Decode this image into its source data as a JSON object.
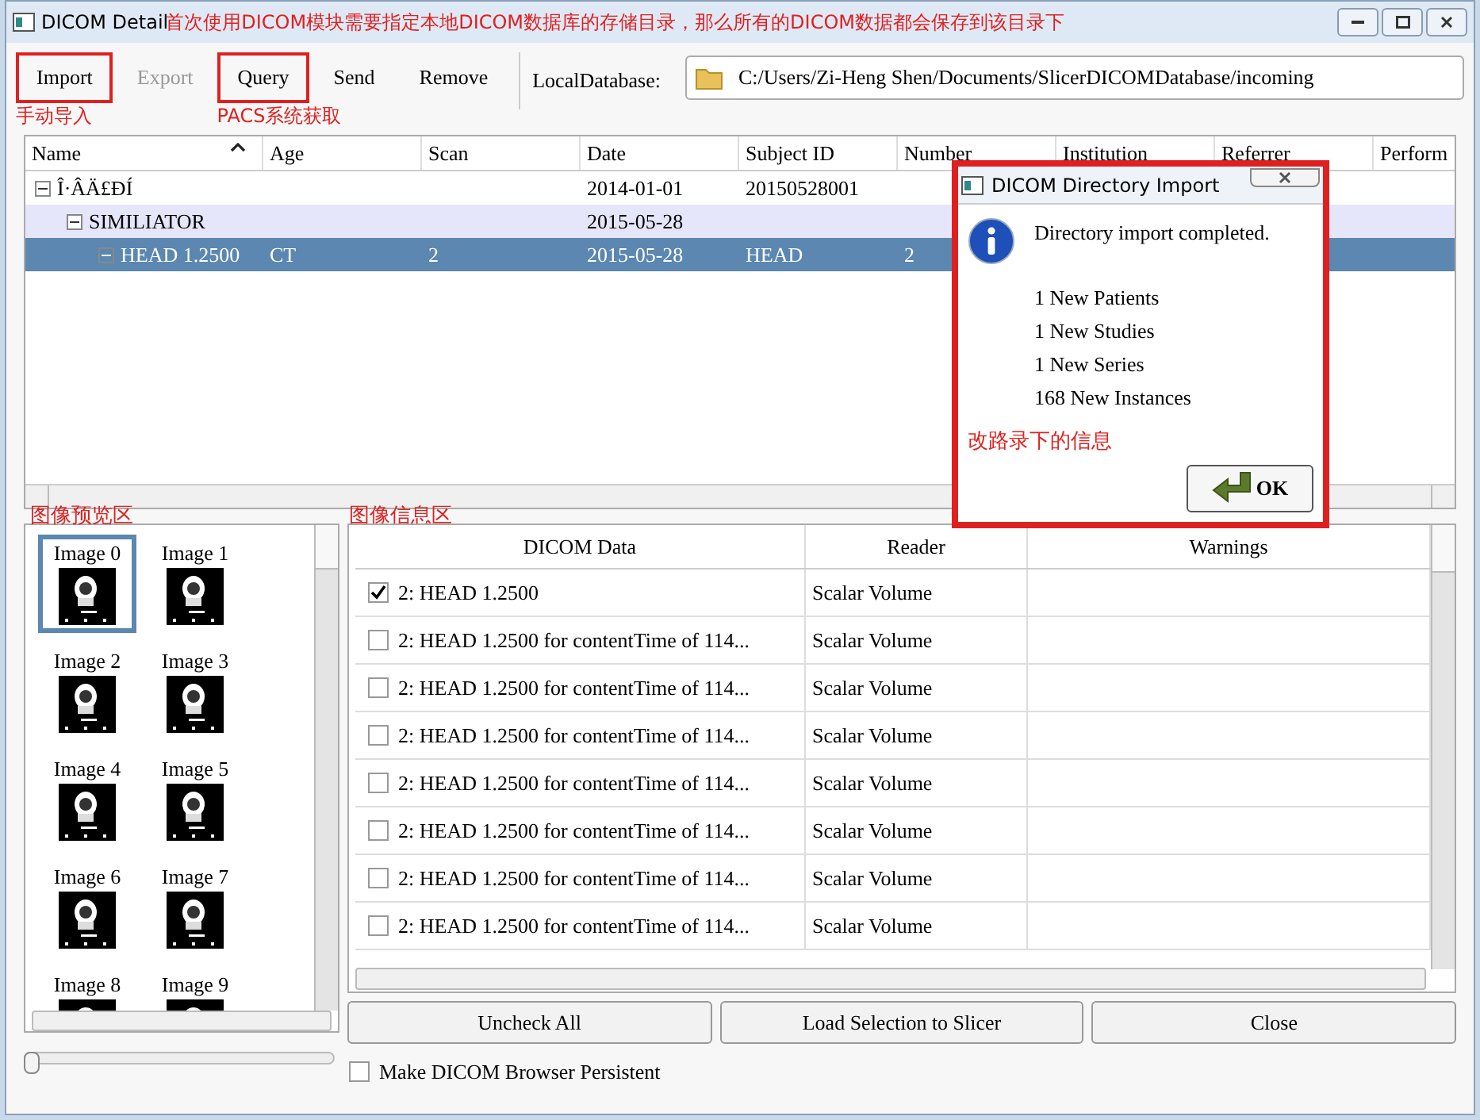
{
  "window": {
    "title": "DICOM Detail"
  },
  "top_note": "首次使用DICOM模块需要指定本地DICOM数据库的存储目录，那么所有的DICOM数据都会保存到该目录下",
  "toolbar": {
    "buttons": [
      {
        "label": "Import",
        "disabled": false,
        "marked": true,
        "note": "手动导入"
      },
      {
        "label": "Export",
        "disabled": true,
        "marked": false
      },
      {
        "label": "Query",
        "disabled": false,
        "marked": true,
        "note": "PACS系统获取"
      },
      {
        "label": "Send",
        "disabled": false,
        "marked": false
      },
      {
        "label": "Remove",
        "disabled": false,
        "marked": false
      }
    ],
    "database_label": "LocalDatabase:",
    "database_path": "C:/Users/Zi-Heng Shen/Documents/SlicerDICOMDatabase/incoming"
  },
  "tree": {
    "columns": [
      "Name",
      "Age",
      "Scan",
      "Date",
      "Subject ID",
      "Number",
      "Institution",
      "Referrer",
      "Perform"
    ],
    "rows": [
      {
        "name": "Î·ÂÄ£ÐÍ",
        "date": "2014-01-01",
        "subject_id": "20150528001",
        "expanded": true,
        "selected": false,
        "highlighted": false,
        "children": [
          {
            "name": "SIMILIATOR",
            "date": "2015-05-28",
            "expanded": true,
            "selected": false,
            "highlighted": true,
            "children": [
              {
                "name": "HEAD 1.2500",
                "age": "CT",
                "scan": "2",
                "date": "2015-05-28",
                "subject_id": "HEAD",
                "number": "2",
                "expanded": true,
                "selected": true,
                "highlighted": false
              }
            ]
          }
        ]
      }
    ]
  },
  "preview": {
    "note": "图像预览区",
    "zoom": {
      "level": 0
    },
    "images": [
      {
        "label": "Image 0",
        "selected": true
      },
      {
        "label": "Image 1",
        "selected": false
      },
      {
        "label": "Image 2",
        "selected": false
      },
      {
        "label": "Image 3",
        "selected": false
      },
      {
        "label": "Image 4",
        "selected": false
      },
      {
        "label": "Image 5",
        "selected": false
      },
      {
        "label": "Image 6",
        "selected": false
      },
      {
        "label": "Image 7",
        "selected": false
      },
      {
        "label": "Image 8",
        "selected": false
      },
      {
        "label": "Image 9",
        "selected": false
      }
    ]
  },
  "loadables": {
    "note": "图像信息区",
    "columns": [
      "DICOM Data",
      "Reader",
      "Warnings"
    ],
    "rows": [
      {
        "label": "2: HEAD 1.2500",
        "reader": "Scalar Volume",
        "checked": true
      },
      {
        "label": "2: HEAD 1.2500 for contentTime of 114...",
        "reader": "Scalar Volume",
        "checked": false
      },
      {
        "label": "2: HEAD 1.2500 for contentTime of 114...",
        "reader": "Scalar Volume",
        "checked": false
      },
      {
        "label": "2: HEAD 1.2500 for contentTime of 114...",
        "reader": "Scalar Volume",
        "checked": false
      },
      {
        "label": "2: HEAD 1.2500 for contentTime of 114...",
        "reader": "Scalar Volume",
        "checked": false
      },
      {
        "label": "2: HEAD 1.2500 for contentTime of 114...",
        "reader": "Scalar Volume",
        "checked": false
      },
      {
        "label": "2: HEAD 1.2500 for contentTime of 114...",
        "reader": "Scalar Volume",
        "checked": false
      },
      {
        "label": "2: HEAD 1.2500 for contentTime of 114...",
        "reader": "Scalar Volume",
        "checked": false
      }
    ]
  },
  "actions": [
    "Uncheck All",
    "Load Selection to Slicer",
    "Close"
  ],
  "persistent": {
    "label": "Make DICOM Browser Persistent",
    "checked": false
  },
  "dialog": {
    "title": "DICOM Directory Import",
    "marked": true,
    "message": "Directory import completed.",
    "details": [
      "1 New Patients",
      "1 New Studies",
      "1 New Series",
      "168 New Instances"
    ],
    "note": "改路录下的信息",
    "ok": "OK"
  }
}
